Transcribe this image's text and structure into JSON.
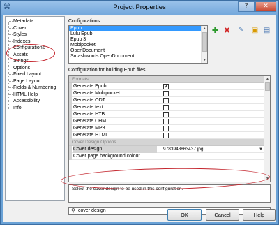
{
  "window": {
    "title": "Project Properties",
    "help_glyph": "?",
    "close_glyph": "✕"
  },
  "tree": {
    "items": [
      {
        "label": "Metadata"
      },
      {
        "label": "Cover"
      },
      {
        "label": "Styles"
      },
      {
        "label": "Indexes"
      },
      {
        "label": "Configurations"
      },
      {
        "label": "Assets"
      },
      {
        "label": "Strings"
      },
      {
        "label": "Options"
      },
      {
        "label": "Fixed Layout"
      },
      {
        "label": "Page Layout"
      },
      {
        "label": "Fields & Numbering"
      },
      {
        "label": "HTML Help"
      },
      {
        "label": "Accessibility"
      },
      {
        "label": "Info"
      }
    ]
  },
  "configurations": {
    "label": "Configurations:",
    "items": [
      "Epub",
      "Lulu Epub",
      "Epub 3",
      "Mobipocket",
      "OpenDocument",
      "Smashwords OpenDocument"
    ],
    "selected": "Epub"
  },
  "toolbar": {
    "add_glyph": "✚",
    "delete_glyph": "✖",
    "icon_color_add": "#2e9a2e",
    "icon_color_delete": "#d02020"
  },
  "build": {
    "label": "Configuration for building Epub files",
    "formats_category": "Formats",
    "format_rows": [
      {
        "name": "Generate Epub",
        "checked": "✔"
      },
      {
        "name": "Generate Mobipocket",
        "checked": ""
      },
      {
        "name": "Generate ODT",
        "checked": ""
      },
      {
        "name": "Generate text",
        "checked": ""
      },
      {
        "name": "Generate HTB",
        "checked": ""
      },
      {
        "name": "Generate CHM",
        "checked": ""
      },
      {
        "name": "Generate MP3",
        "checked": ""
      },
      {
        "name": "Generate HTML",
        "checked": ""
      }
    ],
    "cover_category": "Cover Design Options",
    "cover_rows": [
      {
        "name": "Cover design",
        "value": "9783943863437.jpg"
      },
      {
        "name": "Cover page background colour",
        "value": ""
      }
    ],
    "dropdown_glyph": "▼"
  },
  "description": "Select the cover design to be used in this configuration.",
  "search": {
    "value": "cover design",
    "icon_glyph": "⚲"
  },
  "buttons": {
    "ok": "OK",
    "cancel": "Cancel",
    "help": "Help"
  },
  "annotation_color": "#c4262e"
}
